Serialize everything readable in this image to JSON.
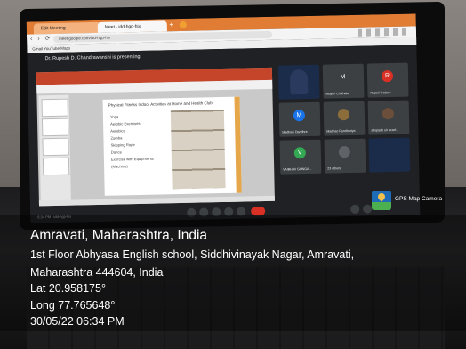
{
  "browser": {
    "tabs": [
      {
        "label": "Edit Meeting"
      },
      {
        "label": "Meet - idd-hgp-hix"
      }
    ],
    "url": "meet.google.com/idd-hgp-hix",
    "bookmarks": "Gmail  YouTube  Maps"
  },
  "meet": {
    "presenting_text": "Dr. Rupesh D. Chandrawanshi is presenting",
    "meeting_code": "6:34 PM | idd-hgp-hix",
    "slide": {
      "title": "Physical Fitness Indoor Activities at Home and Health Club",
      "bullets": [
        "Yoga",
        "Aerobic Exercises",
        "Aerobics",
        "Zumba",
        "Skipping Rope",
        "Dance",
        "Exercise with Equipments",
        "(Machine)"
      ]
    },
    "participants": [
      {
        "name": "",
        "initial": "",
        "color": "#1b2c4a",
        "video": true
      },
      {
        "name": "Mayuri Chikhale",
        "initial": "M",
        "color": "#3c4043"
      },
      {
        "name": "Rupali Gorjare",
        "initial": "R",
        "color": "#d93025"
      },
      {
        "name": "Madhavi Dandhre",
        "initial": "M",
        "color": "#1a73e8"
      },
      {
        "name": "Madhao Pandhariya",
        "initial": "",
        "color": "#3c4043"
      },
      {
        "name": "shopade sir acad...",
        "initial": "",
        "color": "#3c4043"
      },
      {
        "name": "VAIBHAV GUNGA...",
        "initial": "V",
        "color": "#34a853"
      },
      {
        "name": "23 others",
        "initial": "",
        "color": "#3c4043"
      }
    ]
  },
  "gps": {
    "app_name": "GPS Map Camera",
    "location_title": "Amravati, Maharashtra, India",
    "address_line1": "1st Floor Abhyasa English school, Siddhivinayak Nagar, Amravati,",
    "address_line2": "Maharashtra 444604, India",
    "latitude": "Lat 20.958175°",
    "longitude": "Long 77.765648°",
    "datetime": "30/05/22 06:34 PM"
  },
  "colors": {
    "chrome_tabbar": "#e07c34",
    "ppt_ribbon": "#c4452a",
    "meet_bg": "#202124",
    "end_call": "#d93025"
  }
}
